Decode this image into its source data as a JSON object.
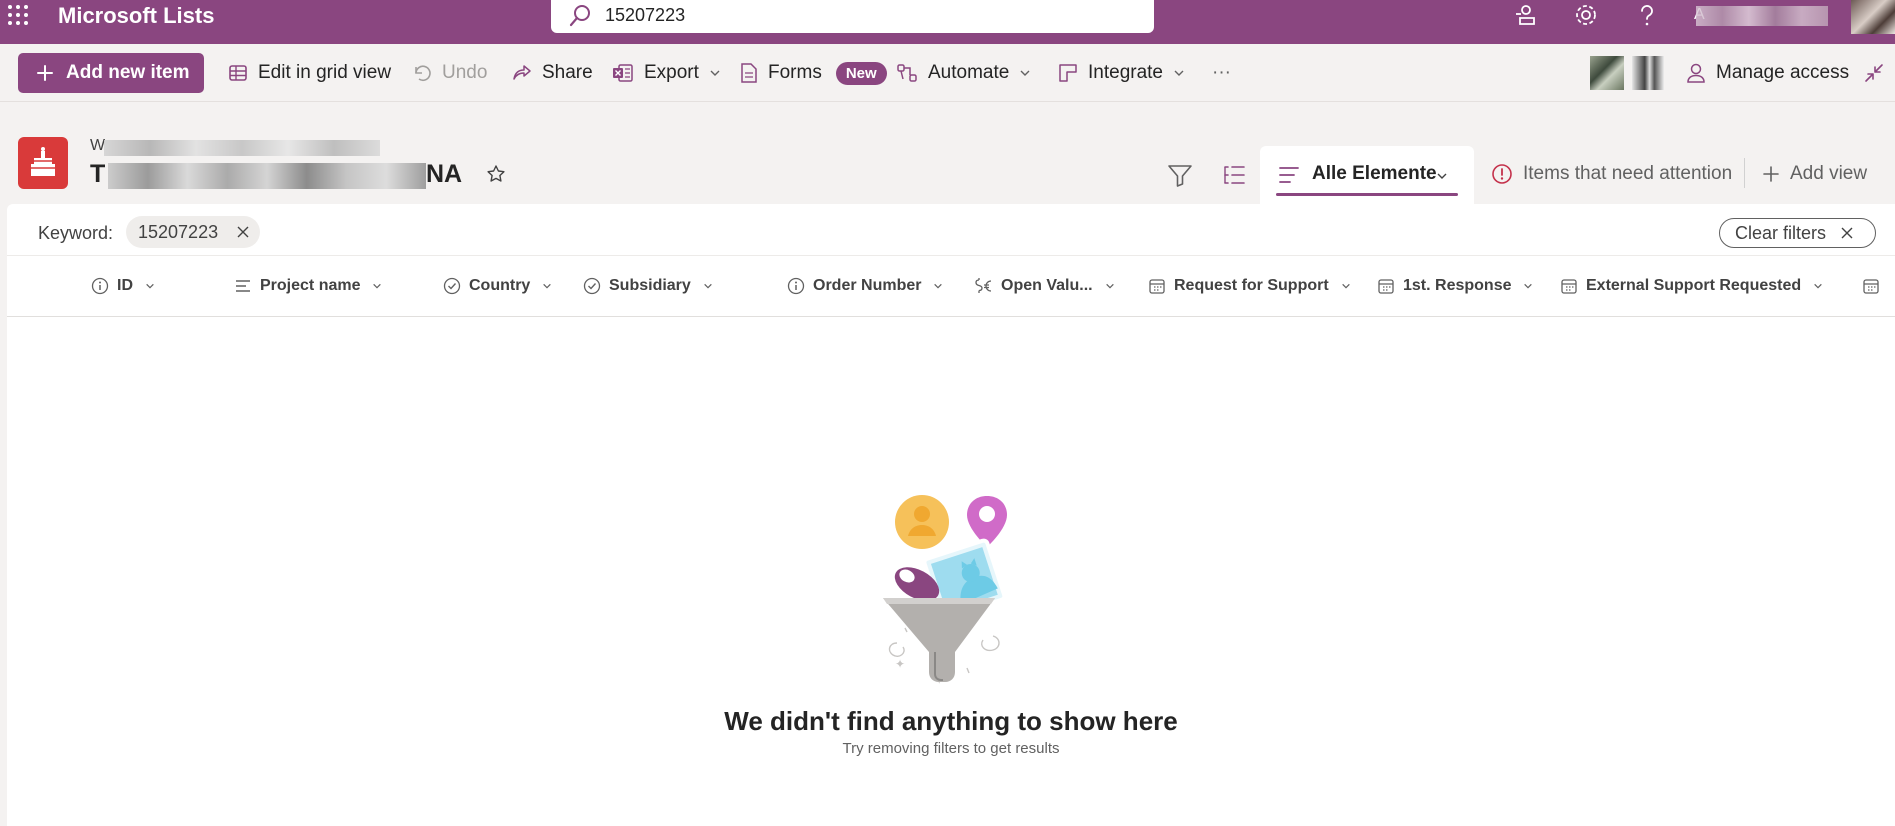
{
  "topbar": {
    "app_title": "Microsoft Lists",
    "search_value": "15207223",
    "user_initial": "A",
    "accent": "#8a4680"
  },
  "commands": {
    "add_new_item": "Add new item",
    "edit_grid": "Edit in grid view",
    "undo": "Undo",
    "share": "Share",
    "export": "Export",
    "forms": "Forms",
    "forms_badge": "New",
    "automate": "Automate",
    "integrate": "Integrate",
    "more": "···",
    "manage_access": "Manage access"
  },
  "list": {
    "site_initial": "W",
    "title_initial": "T",
    "title_suffix": "NA"
  },
  "views": {
    "active": "Alle Elemente",
    "attention": "Items that need attention",
    "add_view": "Add view"
  },
  "filter": {
    "keyword_label": "Keyword:",
    "keyword_value": "15207223",
    "clear_filters": "Clear filters"
  },
  "columns": [
    {
      "label": "ID",
      "icon": "info-icon"
    },
    {
      "label": "Project name",
      "icon": "text-lines-icon"
    },
    {
      "label": "Country",
      "icon": "check-circle-icon"
    },
    {
      "label": "Subsidiary",
      "icon": "check-circle-icon"
    },
    {
      "label": "Order Number",
      "icon": "info-icon"
    },
    {
      "label": "Open Valu...",
      "icon": "currency-icon"
    },
    {
      "label": "Request for Support",
      "icon": "calendar-icon"
    },
    {
      "label": "1st. Response",
      "icon": "calendar-icon"
    },
    {
      "label": "External Support Requested",
      "icon": "calendar-icon"
    }
  ],
  "empty_state": {
    "title": "We didn't find anything to show here",
    "subtitle": "Try removing filters to get results"
  }
}
